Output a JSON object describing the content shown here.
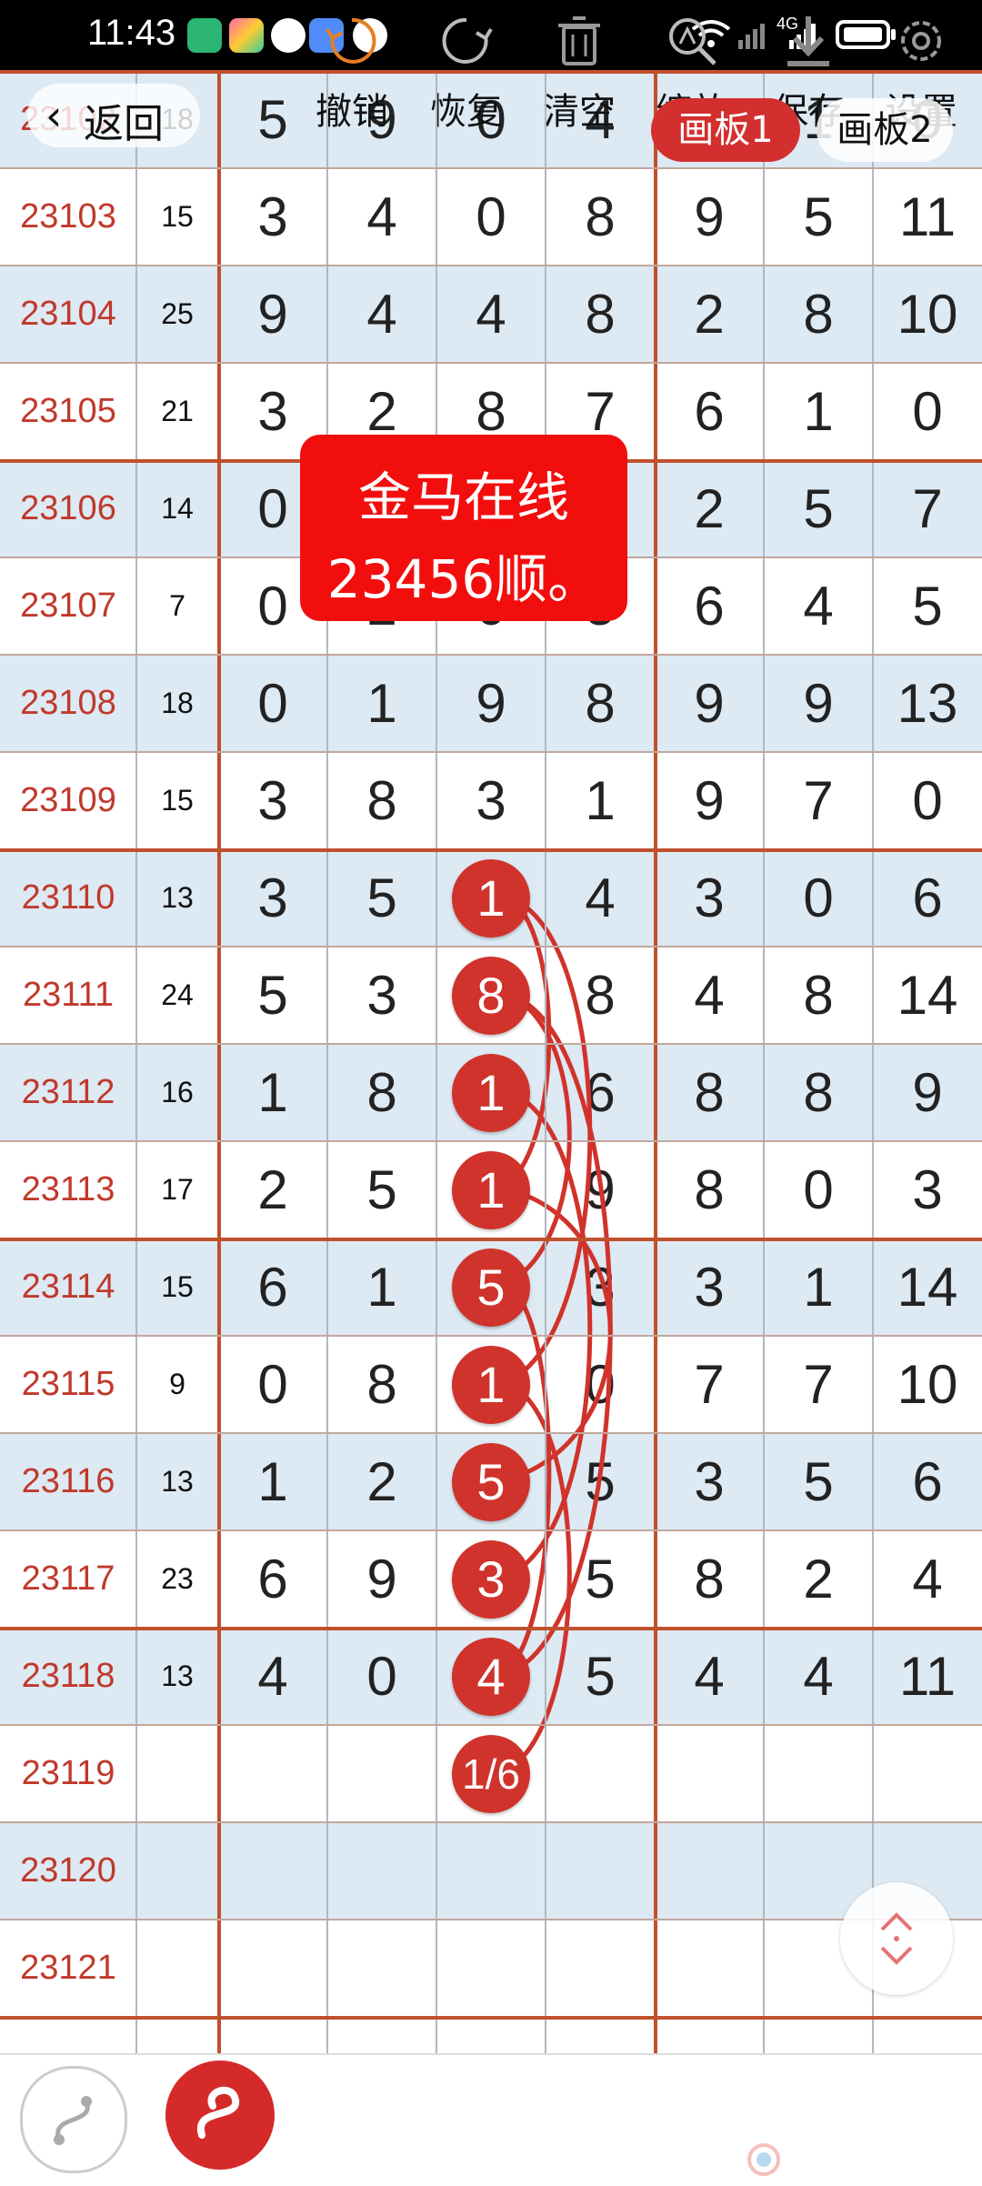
{
  "status_bar": {
    "time": "11:43",
    "network": "4G",
    "battery": "battery-full"
  },
  "nav": {
    "back_label": "返回",
    "tabs": [
      "画板1",
      "画板2"
    ],
    "active_tab": 0
  },
  "note": {
    "line1": "金马在线",
    "line2": "23456顺。"
  },
  "table": {
    "rows": [
      {
        "issue": "23102",
        "sum": "18",
        "digits": [
          "5",
          "9",
          "0",
          "4",
          "",
          "1",
          "0"
        ]
      },
      {
        "issue": "23103",
        "sum": "15",
        "digits": [
          "3",
          "4",
          "0",
          "8",
          "9",
          "5",
          "11"
        ]
      },
      {
        "issue": "23104",
        "sum": "25",
        "digits": [
          "9",
          "4",
          "4",
          "8",
          "2",
          "8",
          "10"
        ]
      },
      {
        "issue": "23105",
        "sum": "21",
        "digits": [
          "3",
          "2",
          "8",
          "7",
          "6",
          "1",
          "0"
        ]
      },
      {
        "issue": "23106",
        "sum": "14",
        "digits": [
          "0",
          "",
          "",
          "",
          "2",
          "5",
          "7"
        ]
      },
      {
        "issue": "23107",
        "sum": "7",
        "digits": [
          "0",
          "2",
          "0",
          "5",
          "6",
          "4",
          "5"
        ]
      },
      {
        "issue": "23108",
        "sum": "18",
        "digits": [
          "0",
          "1",
          "9",
          "8",
          "9",
          "9",
          "13"
        ]
      },
      {
        "issue": "23109",
        "sum": "15",
        "digits": [
          "3",
          "8",
          "3",
          "1",
          "9",
          "7",
          "0"
        ]
      },
      {
        "issue": "23110",
        "sum": "13",
        "digits": [
          "3",
          "5",
          "1",
          "4",
          "3",
          "0",
          "6"
        ]
      },
      {
        "issue": "23111",
        "sum": "24",
        "digits": [
          "5",
          "3",
          "8",
          "8",
          "4",
          "8",
          "14"
        ]
      },
      {
        "issue": "23112",
        "sum": "16",
        "digits": [
          "1",
          "8",
          "1",
          "6",
          "8",
          "8",
          "9"
        ]
      },
      {
        "issue": "23113",
        "sum": "17",
        "digits": [
          "2",
          "5",
          "1",
          "9",
          "8",
          "0",
          "3"
        ]
      },
      {
        "issue": "23114",
        "sum": "15",
        "digits": [
          "6",
          "1",
          "5",
          "3",
          "3",
          "1",
          "14"
        ]
      },
      {
        "issue": "23115",
        "sum": "9",
        "digits": [
          "0",
          "8",
          "1",
          "0",
          "7",
          "7",
          "10"
        ]
      },
      {
        "issue": "23116",
        "sum": "13",
        "digits": [
          "1",
          "2",
          "5",
          "5",
          "3",
          "5",
          "6"
        ]
      },
      {
        "issue": "23117",
        "sum": "23",
        "digits": [
          "6",
          "9",
          "3",
          "5",
          "8",
          "2",
          "4"
        ]
      },
      {
        "issue": "23118",
        "sum": "13",
        "digits": [
          "4",
          "0",
          "4",
          "5",
          "4",
          "4",
          "11"
        ]
      },
      {
        "issue": "23119",
        "sum": "",
        "digits": [
          "",
          "",
          "",
          "",
          "",
          "",
          ""
        ]
      },
      {
        "issue": "23120",
        "sum": "",
        "digits": [
          "",
          "",
          "",
          "",
          "",
          "",
          ""
        ]
      },
      {
        "issue": "23121",
        "sum": "",
        "digits": [
          "",
          "",
          "",
          "",
          "",
          "",
          ""
        ]
      }
    ],
    "marked_column": 2,
    "marked_values": [
      "1",
      "8",
      "1",
      "1",
      "5",
      "1",
      "5",
      "3",
      "4",
      "1/6"
    ],
    "marked_start_row": 8,
    "mark_color": "#d0332b"
  },
  "toolbar": {
    "items": [
      {
        "label": "撤销",
        "icon": "undo-icon"
      },
      {
        "label": "恢复",
        "icon": "redo-icon"
      },
      {
        "label": "清空",
        "icon": "trash-icon"
      },
      {
        "label": "缩放",
        "icon": "zoom-icon"
      },
      {
        "label": "保存",
        "icon": "download-icon"
      },
      {
        "label": "设置",
        "icon": "gear-icon"
      }
    ]
  },
  "colors": {
    "accent": "#d32f2f",
    "grid_line": "#c0512d",
    "shade": "#dde9f3",
    "issue_text": "#c0392b"
  }
}
